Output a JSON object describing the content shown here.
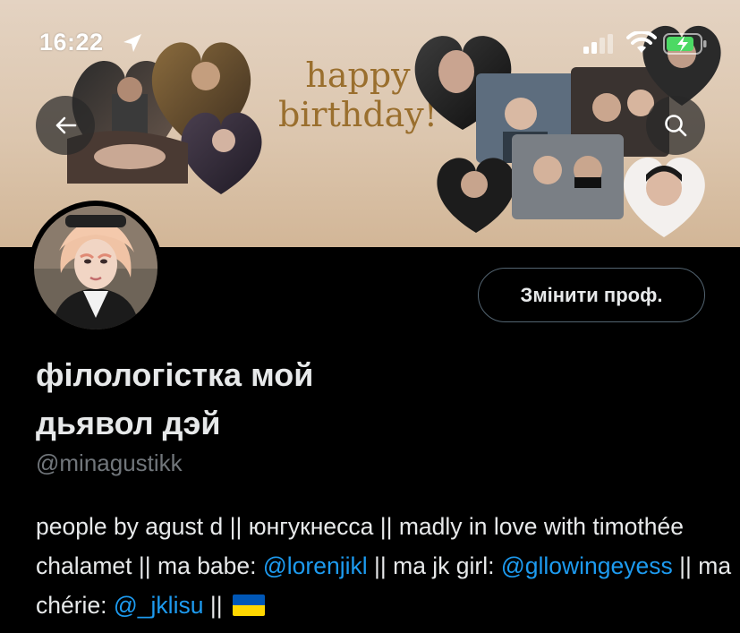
{
  "status_bar": {
    "time": "16:22"
  },
  "banner": {
    "line1": "happy",
    "line2": "birthday!"
  },
  "profile": {
    "edit_label": "Змінити проф.",
    "name_line1": "філологістка мой",
    "name_line2": "дьявол дэй",
    "handle": "@minagustikk"
  },
  "bio": {
    "p1": "people by agust d || юнгукнесса || madly in love with timothée chalamet || ma babe: ",
    "m1": "@lorenjikl",
    "p2": " || ma jk girl: ",
    "m2": "@gllowingeyess",
    "p3": " || ma chérie: ",
    "m3": "@_jklisu",
    "p4": " || "
  },
  "icons": [
    "location-arrow-icon",
    "cellular-signal-icon",
    "wifi-icon",
    "battery-charging-icon",
    "back-arrow-icon",
    "search-icon",
    "ukraine-flag-icon"
  ],
  "colors": {
    "accent": "#1d9bf0",
    "muted": "#71767b",
    "text": "#e7e9ea",
    "banner_text": "#9a6f2e",
    "battery": "#4cd964"
  }
}
